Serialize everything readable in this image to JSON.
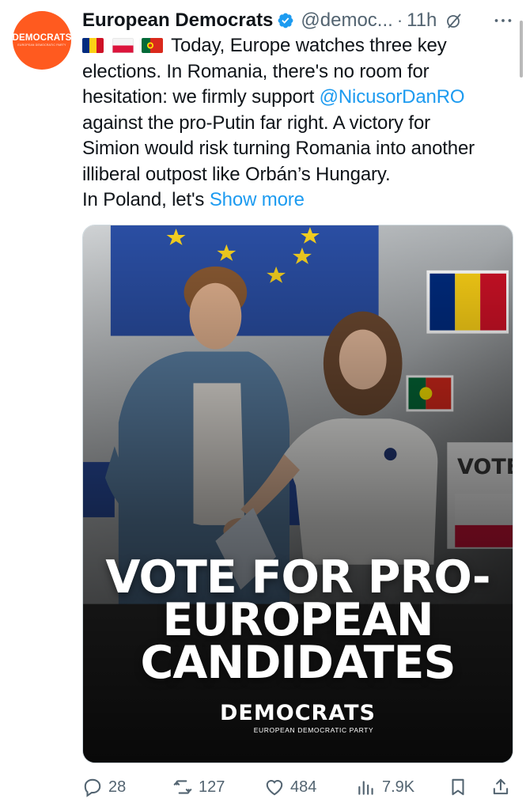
{
  "account": {
    "avatar_text": "DEMOCRATS",
    "avatar_subtext": "EUROPEAN DEMOCRATIC PARTY",
    "display_name": "European Democrats",
    "handle": "@democ...",
    "separator": "·",
    "time": "11h"
  },
  "tweet": {
    "flags": [
      "romania-flag",
      "poland-flag",
      "portugal-flag"
    ],
    "line1": "Today, Europe watches three key",
    "line2": "elections. In Romania, there's no room for",
    "line3_pre": "hesitation: we firmly support ",
    "mention": "@NicusorDanRO",
    "line4": "against the pro-Putin far right. A victory for",
    "line5": "Simion would risk turning Romania into another",
    "line6": "illiberal outpost like Orbán’s Hungary.",
    "line7_pre": "In Poland, let's ",
    "show_more": "Show more"
  },
  "media": {
    "headline_line1": "VOTE FOR PRO-",
    "headline_line2": "EUROPEAN",
    "headline_line3": "CANDIDATES",
    "brand_name": "DEMOCRATS",
    "brand_subtitle": "EUROPEAN DEMOCRATIC PARTY",
    "sign_text": "VOTE"
  },
  "actions": {
    "replies": "28",
    "reposts": "127",
    "likes": "484",
    "views": "7.9K"
  },
  "colors": {
    "accent": "#1d9bf0",
    "brand_orange": "#ff5a1f",
    "muted": "#536471"
  }
}
